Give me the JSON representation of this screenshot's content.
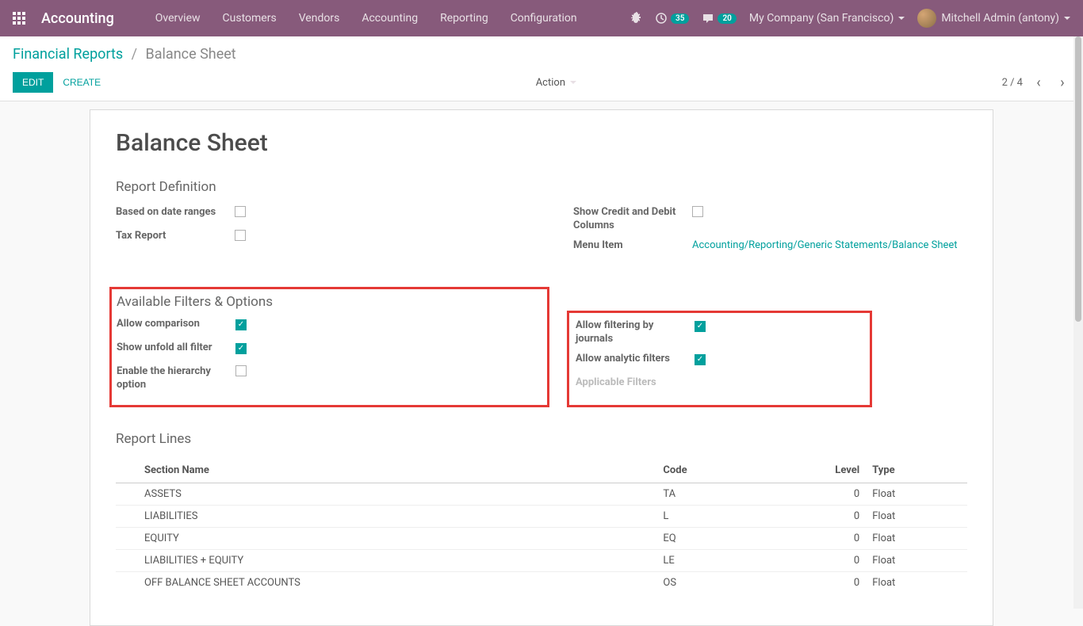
{
  "navbar": {
    "brand": "Accounting",
    "links": [
      "Overview",
      "Customers",
      "Vendors",
      "Accounting",
      "Reporting",
      "Configuration"
    ],
    "badge1": "35",
    "badge2": "20",
    "company": "My Company (San Francisco)",
    "user": "Mitchell Admin (antony)"
  },
  "breadcrumb": {
    "parent": "Financial Reports",
    "current": "Balance Sheet"
  },
  "buttons": {
    "edit": "EDIT",
    "create": "CREATE",
    "action": "Action"
  },
  "pager": {
    "text": "2 / 4"
  },
  "form": {
    "title": "Balance Sheet",
    "report_def_title": "Report Definition",
    "fields_left1": [
      {
        "label": "Based on date ranges",
        "checked": false
      },
      {
        "label": "Tax Report",
        "checked": false
      }
    ],
    "fields_right1": {
      "show_credit_debit": {
        "label": "Show Credit and Debit Columns",
        "checked": false
      },
      "menu_item": {
        "label": "Menu Item",
        "value": "Accounting/Reporting/Generic Statements/Balance Sheet"
      }
    },
    "filters_title": "Available Filters & Options",
    "filters_left": [
      {
        "label": "Allow comparison",
        "checked": true
      },
      {
        "label": "Show unfold all filter",
        "checked": true
      },
      {
        "label": "Enable the hierarchy option",
        "checked": false
      }
    ],
    "filters_right": [
      {
        "label": "Allow filtering by journals",
        "checked": true
      },
      {
        "label": "Allow analytic filters",
        "checked": true
      }
    ],
    "applicable_filters_label": "Applicable Filters",
    "report_lines_title": "Report Lines",
    "columns": {
      "section": "Section Name",
      "code": "Code",
      "level": "Level",
      "type": "Type"
    },
    "rows": [
      {
        "section": "ASSETS",
        "code": "TA",
        "level": "0",
        "type": "Float"
      },
      {
        "section": "LIABILITIES",
        "code": "L",
        "level": "0",
        "type": "Float"
      },
      {
        "section": "EQUITY",
        "code": "EQ",
        "level": "0",
        "type": "Float"
      },
      {
        "section": "LIABILITIES + EQUITY",
        "code": "LE",
        "level": "0",
        "type": "Float"
      },
      {
        "section": "OFF BALANCE SHEET ACCOUNTS",
        "code": "OS",
        "level": "0",
        "type": "Float"
      }
    ]
  }
}
